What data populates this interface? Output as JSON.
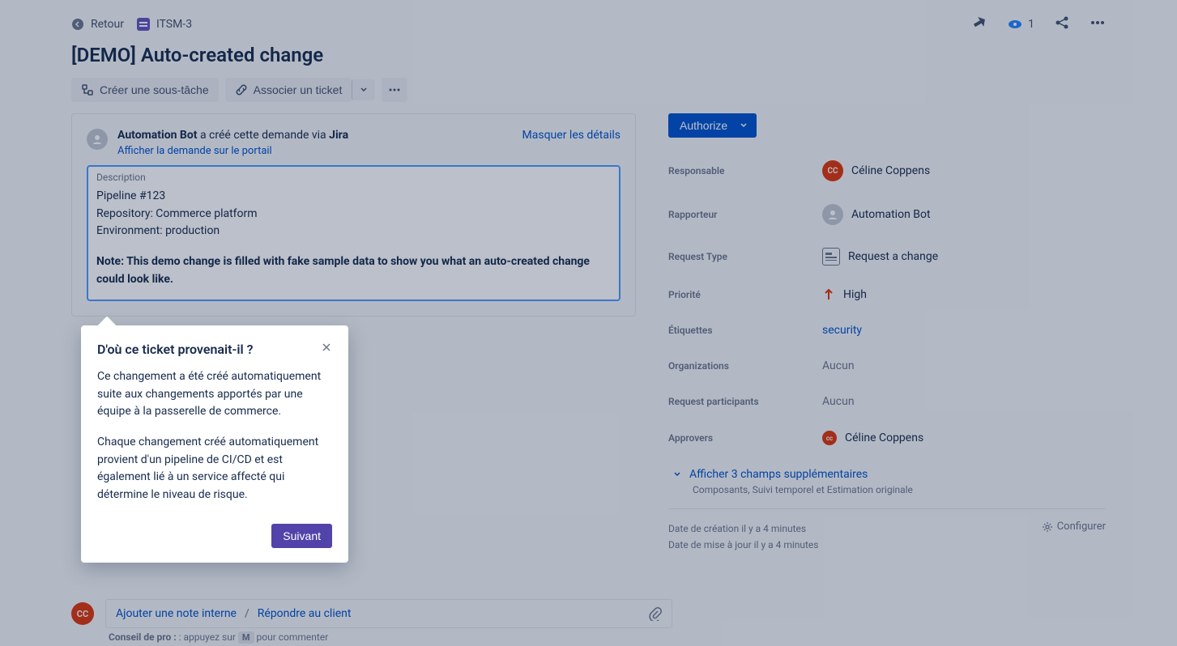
{
  "breadcrumbs": {
    "back": "Retour",
    "issue_key": "ITSM-3"
  },
  "header_actions": {
    "watchers": "1"
  },
  "issue": {
    "title": "[DEMO] Auto-created change"
  },
  "actions": {
    "create_subtask": "Créer une sous-tâche",
    "link_ticket": "Associer un ticket"
  },
  "request_panel": {
    "bot_name": "Automation Bot",
    "created_text": " a créé cette demande via ",
    "via": "Jira",
    "portal_link": "Afficher la demande sur le portail",
    "hide_details": "Masquer les détails"
  },
  "description": {
    "label": "Description",
    "line1": "Pipeline #123",
    "line2": "Repository: Commerce platform",
    "line3": "Environment: production",
    "note": "Note: This demo change is filled with fake sample data to show you what an auto-created change could look like."
  },
  "popover": {
    "title": "D'où ce ticket provenait-il ?",
    "p1": "Ce changement a été créé automatiquement suite aux changements apportés par une équipe à la passerelle de commerce.",
    "p2": "Chaque changement créé automatiquement provient d'un pipeline de CI/CD et est également lié à un service affecté qui détermine le niveau de risque.",
    "next": "Suivant"
  },
  "comment": {
    "internal_note": "Ajouter une note interne",
    "reply_client": "Répondre au client",
    "pro_tip_label": "Conseil de pro :",
    "pro_tip_text": " : appuyez sur ",
    "pro_tip_key": "M",
    "pro_tip_after": " pour commenter"
  },
  "sidebar": {
    "status": "Authorize",
    "fields": {
      "responsable_label": "Responsable",
      "responsable_value": "Céline Coppens",
      "rapporteur_label": "Rapporteur",
      "rapporteur_value": "Automation Bot",
      "request_type_label": "Request Type",
      "request_type_value": "Request a change",
      "priority_label": "Priorité",
      "priority_value": "High",
      "etiquettes_label": "Étiquettes",
      "etiquettes_value": "security",
      "organizations_label": "Organizations",
      "organizations_value": "Aucun",
      "participants_label": "Request participants",
      "participants_value": "Aucun",
      "approvers_label": "Approvers",
      "approvers_value": "Céline Coppens"
    },
    "show_more": "Afficher 3 champs supplémentaires",
    "show_more_sub": "Composants, Suivi temporel et Estimation originale",
    "created_at": "Date de création il y a 4 minutes",
    "updated_at": "Date de mise à jour il y a 4 minutes",
    "configure": "Configurer"
  }
}
